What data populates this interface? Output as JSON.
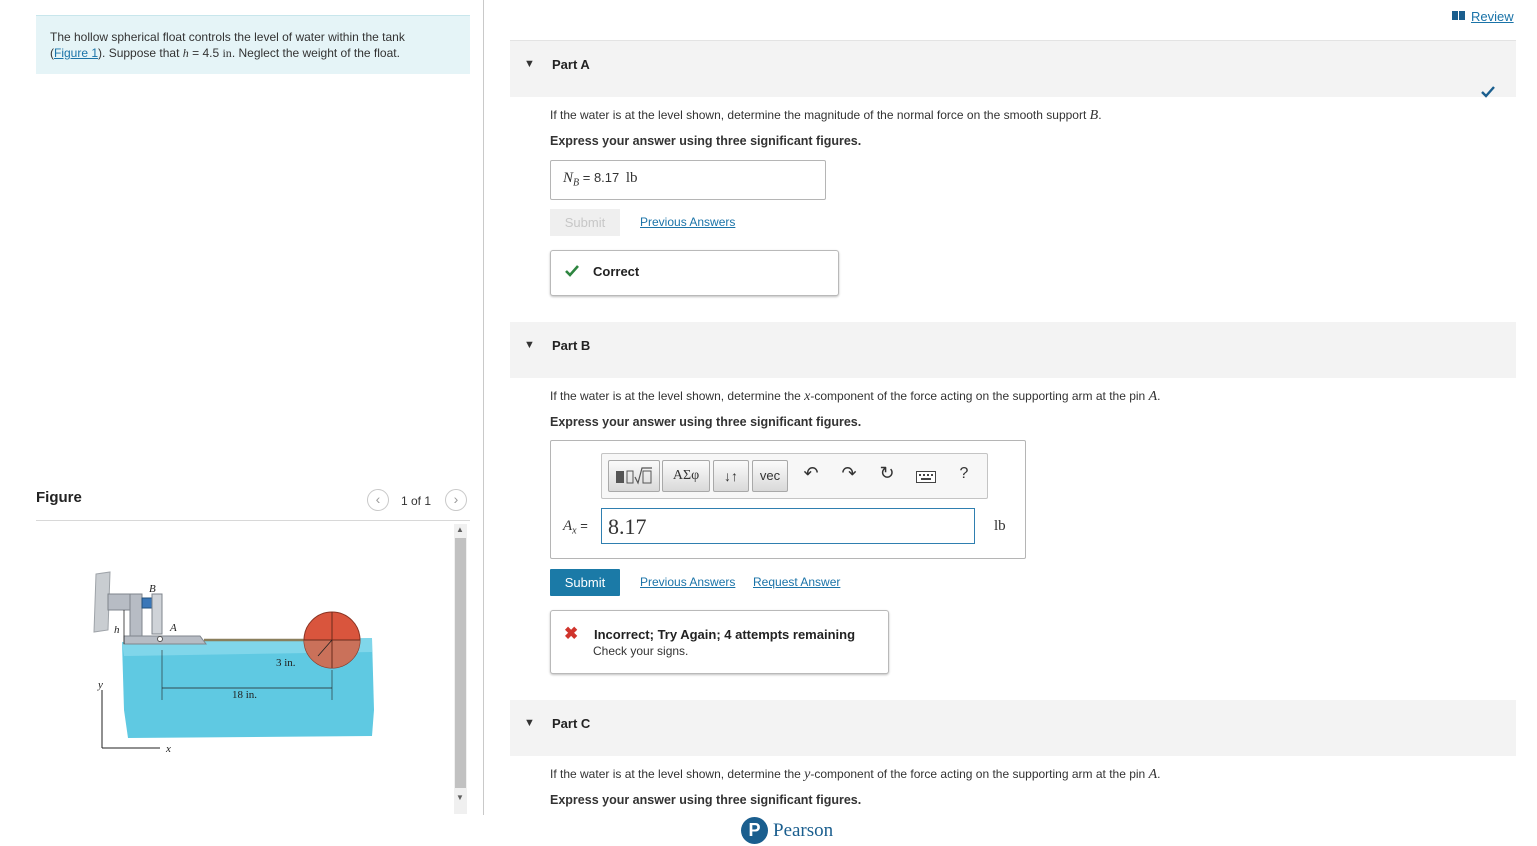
{
  "problem": {
    "text_1": "The hollow spherical float controls the level of water within the tank",
    "figure_link": "Figure 1",
    "text_2": "). Suppose that ",
    "h_var": "h",
    "h_value": " = 4.5 ",
    "h_unit": "in",
    "text_3": ". Neglect the weight of the float."
  },
  "figure": {
    "title": "Figure",
    "prev_icon": "chevron-left-icon",
    "next_icon": "chevron-right-icon",
    "counter": "1 of 1",
    "labels": {
      "B": "B",
      "A": "A",
      "h": "h",
      "y": "y",
      "x": "x",
      "dim_3in": "3 in.",
      "dim_18in": "18 in."
    },
    "colors": {
      "water": "#5fc9e2",
      "float": "#d9553d",
      "arm": "#b7bcc4"
    }
  },
  "review": {
    "label": "Review",
    "icon": "book-icon",
    "status_icon": "checkmark-icon"
  },
  "parts": [
    {
      "label": "Part A",
      "question_pre": "If the water is at the level shown, determine the magnitude of the normal force on the smooth support ",
      "question_var": "B",
      "question_post": ".",
      "instruction": "Express your answer using three significant figures.",
      "answer_var": "N",
      "answer_sub": "B",
      "answer_eq": " = ",
      "answer_value": "8.17",
      "answer_unit": "lb",
      "submit_label": "Submit",
      "previous_answers": "Previous Answers",
      "feedback": "Correct",
      "feedback_color": "#2e8540"
    },
    {
      "label": "Part B",
      "question_pre": "If the water is at the level shown, determine the ",
      "question_var": "x",
      "question_post": "-component of the force acting on the supporting arm at the pin ",
      "question_var2": "A",
      "question_end": ".",
      "instruction": "Express your answer using three significant figures.",
      "toolbar": {
        "templates_icon": "templates-icon",
        "greek": "ΑΣφ",
        "arrows": "↓↑",
        "vec": "vec",
        "undo_icon": "undo-icon",
        "redo_icon": "redo-icon",
        "reset_icon": "reset-icon",
        "keyboard_icon": "keyboard-icon",
        "help": "?"
      },
      "answer_var": "A",
      "answer_sub": "x",
      "answer_eq": " = ",
      "answer_value": "8.17",
      "answer_unit": "lb",
      "submit_label": "Submit",
      "previous_answers": "Previous Answers",
      "request_answer": "Request Answer",
      "feedback": "Incorrect; Try Again; 4 attempts remaining",
      "feedback_detail": "Check your signs.",
      "feedback_color": "#d0342c"
    },
    {
      "label": "Part C",
      "question_pre": "If the water is at the level shown, determine the ",
      "question_var": "y",
      "question_post": "-component of the force acting on the supporting arm at the pin ",
      "question_var2": "A",
      "question_end": ".",
      "instruction": "Express your answer using three significant figures."
    }
  ],
  "brand": {
    "name": "Pearson",
    "logo_letter": "P",
    "color": "#1a5e8e"
  }
}
